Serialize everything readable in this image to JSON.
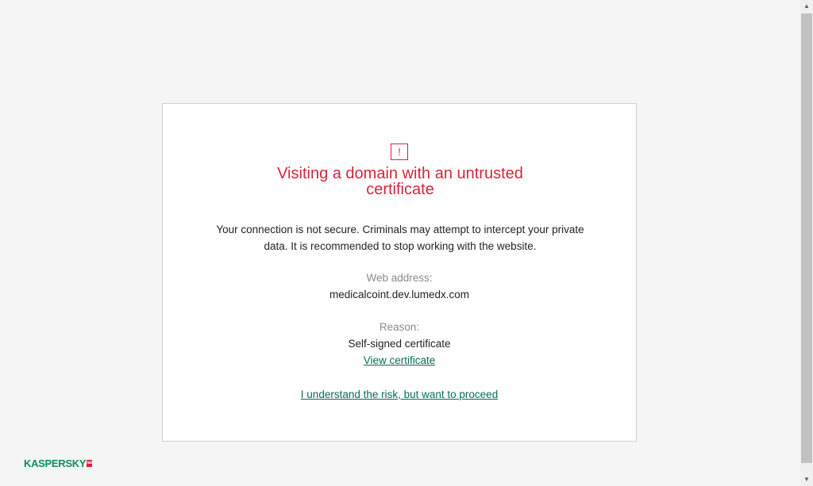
{
  "warning": {
    "icon": "exclamation-icon",
    "icon_glyph": "!",
    "title_line1": "Visiting a domain with an untrusted",
    "title_line2": "certificate",
    "description_line1": "Your connection is not secure. Criminals may attempt to intercept your private",
    "description_line2": "data. It is recommended to stop working with the website."
  },
  "details": {
    "web_address_label": "Web address:",
    "web_address_value": "medicalcoint.dev.lumedx.com",
    "reason_label": "Reason:",
    "reason_value": "Self-signed certificate"
  },
  "actions": {
    "view_certificate": "View certificate",
    "proceed": "I understand the risk, but want to proceed"
  },
  "branding": {
    "logo_text": "KASPERSKY",
    "logo_badge": "lab"
  },
  "colors": {
    "accent_red": "#d5243a",
    "link_green": "#0b6a55",
    "brand_green": "#0b8f5a",
    "page_background": "#f5f5f5"
  },
  "scrollbar": {
    "up_arrow_icon": "triangle-up-icon",
    "down_arrow_icon": "triangle-down-icon",
    "up_glyph": "▲",
    "down_glyph": "▼"
  }
}
